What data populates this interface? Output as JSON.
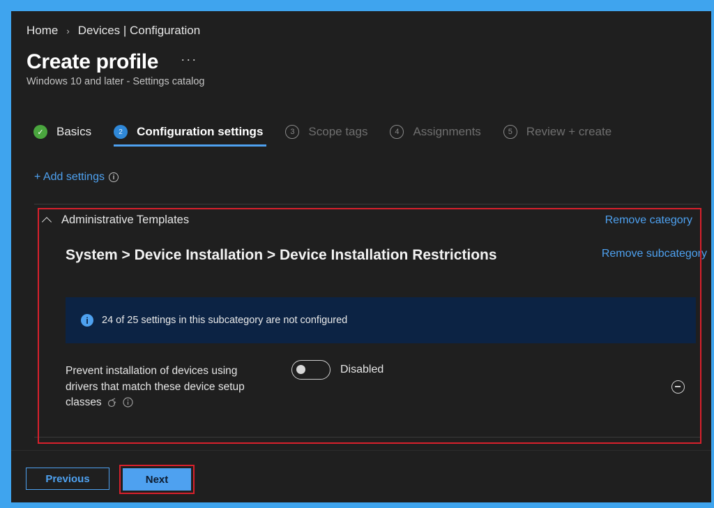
{
  "breadcrumb": {
    "home": "Home",
    "separator": "›",
    "devices": "Devices | Configuration"
  },
  "page": {
    "title": "Create profile",
    "more": "···",
    "subtitle": "Windows 10 and later - Settings catalog"
  },
  "steps": [
    {
      "number": "✓",
      "label": "Basics",
      "state": "done"
    },
    {
      "number": "2",
      "label": "Configuration settings",
      "state": "active"
    },
    {
      "number": "3",
      "label": "Scope tags",
      "state": "future"
    },
    {
      "number": "4",
      "label": "Assignments",
      "state": "future"
    },
    {
      "number": "5",
      "label": "Review + create",
      "state": "future"
    }
  ],
  "add_settings": {
    "label": "+ Add settings",
    "info": "i"
  },
  "category": {
    "name": "Administrative Templates",
    "remove_category": "Remove category",
    "subcategory_path": "System > Device Installation > Device Installation Restrictions",
    "remove_subcategory": "Remove subcategory",
    "banner": {
      "icon": "i",
      "text": "24 of 25 settings in this subcategory are not configured"
    },
    "setting": {
      "label": "Prevent installation of devices using drivers that match these device setup classes",
      "toggle_state": "Disabled",
      "toggle_on": false,
      "icons": [
        "policy-icon",
        "info-icon"
      ]
    }
  },
  "footer": {
    "previous": "Previous",
    "next": "Next"
  },
  "colors": {
    "accent": "#4ea1f0",
    "highlight": "#d9202c",
    "success": "#4aa63e",
    "background": "#1f1f1f",
    "banner": "#0c2344"
  }
}
